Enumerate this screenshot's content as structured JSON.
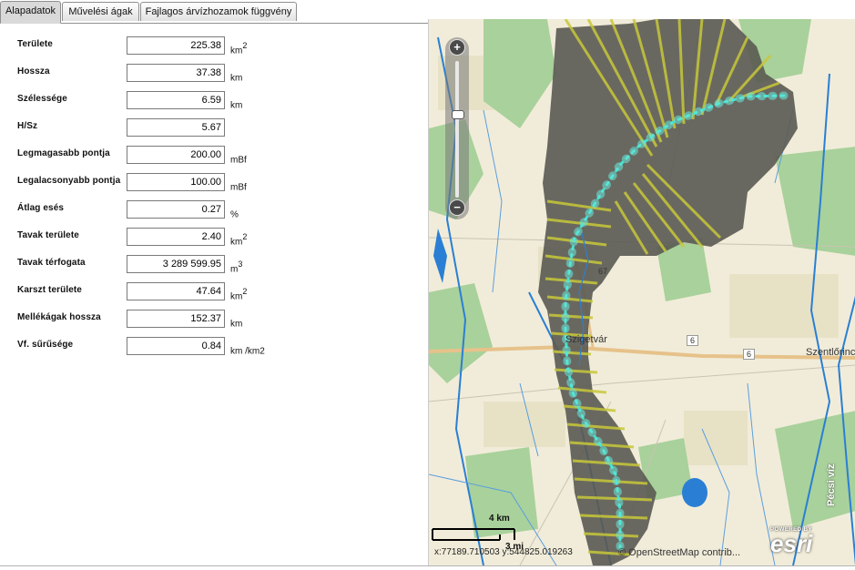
{
  "tabs": [
    {
      "label": "Alapadatok",
      "active": true
    },
    {
      "label": "Művelési ágak",
      "active": false
    },
    {
      "label": "Fajlagos árvízhozamok függvény",
      "active": false
    }
  ],
  "fields": [
    {
      "label": "Területe",
      "value": "225.38",
      "unit": "km",
      "sup": "2"
    },
    {
      "label": "Hossza",
      "value": "37.38",
      "unit": "km",
      "sup": ""
    },
    {
      "label": "Szélessége",
      "value": "6.59",
      "unit": "km",
      "sup": ""
    },
    {
      "label": "H/Sz",
      "value": "5.67",
      "unit": "",
      "sup": ""
    },
    {
      "label": "Legmagasabb pontja",
      "value": "200.00",
      "unit": "mBf",
      "sup": ""
    },
    {
      "label": "Legalacsonyabb pontja",
      "value": "100.00",
      "unit": "mBf",
      "sup": ""
    },
    {
      "label": "Átlag esés",
      "value": "0.27",
      "unit": "%",
      "sup": ""
    },
    {
      "label": "Tavak területe",
      "value": "2.40",
      "unit": "km",
      "sup": "2"
    },
    {
      "label": "Tavak térfogata",
      "value": "3 289 599.95",
      "unit": "m",
      "sup": "3"
    },
    {
      "label": "Karszt területe",
      "value": "47.64",
      "unit": "km",
      "sup": "2"
    },
    {
      "label": "Mellékágak hossza",
      "value": "152.37",
      "unit": "km",
      "sup": ""
    },
    {
      "label": "Vf. sűrűsége",
      "value": "0.84",
      "unit": "km /km2",
      "sup": ""
    }
  ],
  "map": {
    "zoom_in": "+",
    "zoom_out": "−",
    "scale_km": "4 km",
    "scale_mi": "3 mi",
    "coords": "x:77189.710503 y:544825.019263",
    "attribution": "© OpenStreetMap contrib...",
    "powered_by": "POWERED BY",
    "esri": "esri",
    "credit": "Pécsi víz",
    "town_1": "Szigetvár",
    "town_2": "Szentlőrinc",
    "road_6a": "6",
    "road_6b": "6",
    "road_67": "67",
    "colors": {
      "basin": "#5a5a52",
      "transect": "#c8c83a",
      "river_line": "#40e0d0",
      "water": "#2a7fd4",
      "forest": "#8fc88a",
      "background": "#f1ecd9"
    },
    "icons": [
      "zoom-in-icon",
      "zoom-out-icon"
    ]
  }
}
